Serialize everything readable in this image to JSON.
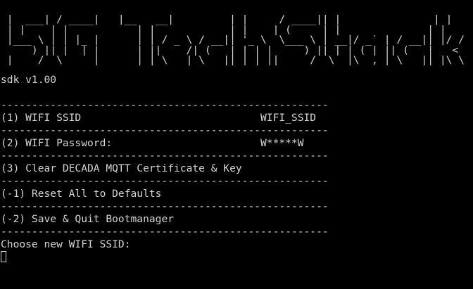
{
  "banner": [
    "  _____   _____     _______           _       _____  _                 _    ",
    " |  ___| / ____|   |__   __|         | |     / ____|| |               | |   ",
    " | |__  | |  __       | |  ___   ___ | |__  | (___  | |_  __ _   ___ | | __",
    " |___ \\ | | |_ |      | | / _ \\ / __|| '_ \\  \\___ \\ | __|/ _` | / __|| |/ /",
    "  ___) || |__| |      | ||  __/| (__ | | | | ____) || |_| (_| || (__ |   < ",
    " |____/  \\_____|      |_| \\___| \\___||_| |_||_____/  \\__|\\__,_| \\___||_|\\_\\"
  ],
  "version": "sdk v1.00",
  "separator": "-----------------------------------------------------",
  "menu": [
    {
      "label": "(1) WIFI SSID",
      "value": "WIFI_SSID"
    },
    {
      "label": "(2) WIFI Password:",
      "value": "W*****W"
    },
    {
      "label": "(3) Clear DECADA MQTT Certificate & Key",
      "value": ""
    },
    {
      "label": "(-1) Reset All to Defaults",
      "value": ""
    },
    {
      "label": "(-2) Save & Quit Bootmanager",
      "value": ""
    }
  ],
  "prompt": "Choose new WIFI SSID:",
  "colors": {
    "background": "#000000",
    "foreground": "#d4d4d4"
  }
}
